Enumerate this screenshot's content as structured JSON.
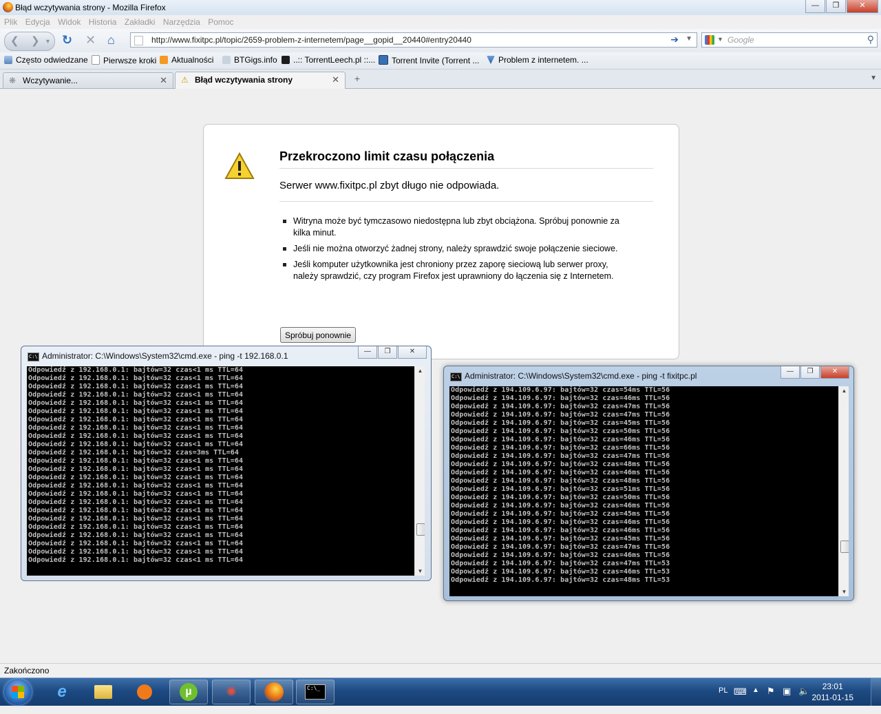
{
  "window": {
    "title": "Błąd wczytywania strony - Mozilla Firefox",
    "min_icon": "minimize-icon",
    "max_icon": "maximize-icon",
    "close_icon": "close-icon"
  },
  "menu": [
    "Plik",
    "Edycja",
    "Widok",
    "Historia",
    "Zakładki",
    "Narzędzia",
    "Pomoc"
  ],
  "nav": {
    "url": "http://www.fixitpc.pl/topic/2659-problem-z-internetem/page__gopid__20440#entry20440",
    "search_placeholder": "Google"
  },
  "bookmarks": [
    "Często odwiedzane",
    "Pierwsze kroki",
    "Aktualności",
    "BTGigs.info",
    "..:: TorrentLeech.pl ::...",
    "Torrent Invite (Torrent ...",
    "Problem z internetem. ..."
  ],
  "tabs": [
    {
      "label": "Wczytywanie...",
      "active": false
    },
    {
      "label": "Błąd wczytywania strony",
      "active": true
    }
  ],
  "error": {
    "title": "Przekroczono limit czasu połączenia",
    "short": "Serwer www.fixitpc.pl zbyt długo nie odpowiada.",
    "bullets": [
      "Witryna może być tymczasowo niedostępna lub zbyt obciążona. Spróbuj ponownie za kilka minut.",
      "Jeśli nie można otworzyć żadnej strony, należy sprawdzić swoje połączenie sieciowe.",
      "Jeśli komputer użytkownika jest chroniony przez zaporę sieciową lub serwer proxy, należy sprawdzić, czy program Firefox jest uprawniony do łączenia się z Internetem."
    ],
    "retry_label": "Spróbuj ponownie"
  },
  "cmd1": {
    "title": "Administrator: C:\\Windows\\System32\\cmd.exe - ping  -t 192.168.0.1",
    "lines": [
      "Odpowiedź z 192.168.0.1: bajtów=32 czas<1 ms TTL=64",
      "Odpowiedź z 192.168.0.1: bajtów=32 czas<1 ms TTL=64",
      "Odpowiedź z 192.168.0.1: bajtów=32 czas<1 ms TTL=64",
      "Odpowiedź z 192.168.0.1: bajtów=32 czas<1 ms TTL=64",
      "Odpowiedź z 192.168.0.1: bajtów=32 czas<1 ms TTL=64",
      "Odpowiedź z 192.168.0.1: bajtów=32 czas<1 ms TTL=64",
      "Odpowiedź z 192.168.0.1: bajtów=32 czas<1 ms TTL=64",
      "Odpowiedź z 192.168.0.1: bajtów=32 czas<1 ms TTL=64",
      "Odpowiedź z 192.168.0.1: bajtów=32 czas<1 ms TTL=64",
      "Odpowiedź z 192.168.0.1: bajtów=32 czas<1 ms TTL=64",
      "Odpowiedź z 192.168.0.1: bajtów=32 czas=3ms TTL=64",
      "Odpowiedź z 192.168.0.1: bajtów=32 czas<1 ms TTL=64",
      "Odpowiedź z 192.168.0.1: bajtów=32 czas<1 ms TTL=64",
      "Odpowiedź z 192.168.0.1: bajtów=32 czas<1 ms TTL=64",
      "Odpowiedź z 192.168.0.1: bajtów=32 czas<1 ms TTL=64",
      "Odpowiedź z 192.168.0.1: bajtów=32 czas<1 ms TTL=64",
      "Odpowiedź z 192.168.0.1: bajtów=32 czas<1 ms TTL=64",
      "Odpowiedź z 192.168.0.1: bajtów=32 czas<1 ms TTL=64",
      "Odpowiedź z 192.168.0.1: bajtów=32 czas<1 ms TTL=64",
      "Odpowiedź z 192.168.0.1: bajtów=32 czas<1 ms TTL=64",
      "Odpowiedź z 192.168.0.1: bajtów=32 czas<1 ms TTL=64",
      "Odpowiedź z 192.168.0.1: bajtów=32 czas<1 ms TTL=64",
      "Odpowiedź z 192.168.0.1: bajtów=32 czas<1 ms TTL=64",
      "Odpowiedź z 192.168.0.1: bajtów=32 czas<1 ms TTL=64"
    ]
  },
  "cmd2": {
    "title": "Administrator: C:\\Windows\\System32\\cmd.exe - ping  -t fixitpc.pl",
    "lines": [
      "Odpowiedź z 194.109.6.97: bajtów=32 czas=54ms TTL=56",
      "Odpowiedź z 194.109.6.97: bajtów=32 czas=46ms TTL=56",
      "Odpowiedź z 194.109.6.97: bajtów=32 czas=47ms TTL=56",
      "Odpowiedź z 194.109.6.97: bajtów=32 czas=47ms TTL=56",
      "Odpowiedź z 194.109.6.97: bajtów=32 czas=45ms TTL=56",
      "Odpowiedź z 194.109.6.97: bajtów=32 czas=50ms TTL=56",
      "Odpowiedź z 194.109.6.97: bajtów=32 czas=46ms TTL=56",
      "Odpowiedź z 194.109.6.97: bajtów=32 czas=66ms TTL=56",
      "Odpowiedź z 194.109.6.97: bajtów=32 czas=47ms TTL=56",
      "Odpowiedź z 194.109.6.97: bajtów=32 czas=48ms TTL=56",
      "Odpowiedź z 194.109.6.97: bajtów=32 czas=46ms TTL=56",
      "Odpowiedź z 194.109.6.97: bajtów=32 czas=48ms TTL=56",
      "Odpowiedź z 194.109.6.97: bajtów=32 czas=51ms TTL=56",
      "Odpowiedź z 194.109.6.97: bajtów=32 czas=50ms TTL=56",
      "Odpowiedź z 194.109.6.97: bajtów=32 czas=46ms TTL=56",
      "Odpowiedź z 194.109.6.97: bajtów=32 czas=45ms TTL=56",
      "Odpowiedź z 194.109.6.97: bajtów=32 czas=46ms TTL=56",
      "Odpowiedź z 194.109.6.97: bajtów=32 czas=46ms TTL=56",
      "Odpowiedź z 194.109.6.97: bajtów=32 czas=45ms TTL=56",
      "Odpowiedź z 194.109.6.97: bajtów=32 czas=47ms TTL=56",
      "Odpowiedź z 194.109.6.97: bajtów=32 czas=46ms TTL=56",
      "Odpowiedź z 194.109.6.97: bajtów=32 czas=47ms TTL=53",
      "Odpowiedź z 194.109.6.97: bajtów=32 czas=46ms TTL=53",
      "Odpowiedź z 194.109.6.97: bajtów=32 czas=48ms TTL=53"
    ]
  },
  "status": "Zakończono",
  "taskbar": {
    "language": "PL",
    "time": "23:01",
    "date": "2011-01-15"
  }
}
